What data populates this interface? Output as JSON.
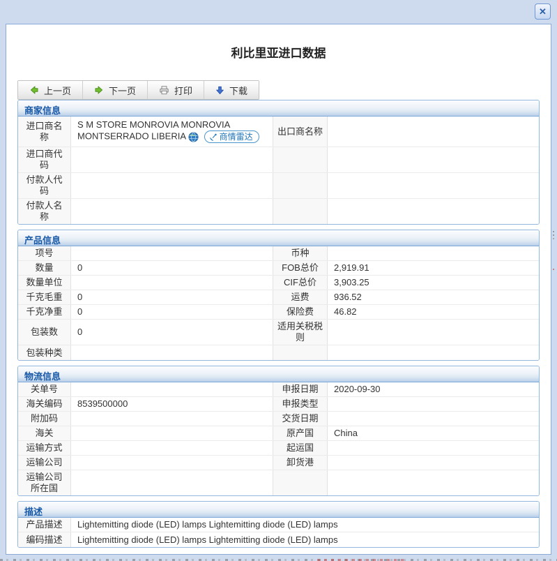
{
  "window": {
    "title": "利比里亚进口数据"
  },
  "icons": {
    "close": "✕",
    "prev": "green-left-arrow",
    "next": "green-right-arrow",
    "print": "printer",
    "download": "blue-down-arrow",
    "globe": "blue-globe",
    "radar": "satellite-dish"
  },
  "colors": {
    "page_bg": "#cedbee",
    "modal_border": "#8aabd8",
    "section_border": "#94b7de",
    "section_header_text": "#1758a7",
    "header_gradient_bottom": "#b9cfe9",
    "arrow_green": "#72bf2f",
    "download_blue": "#4271cf",
    "radar_blue": "#2e83c3",
    "text": "#333333"
  },
  "toolbar": {
    "prev": "上一页",
    "next": "下一页",
    "print": "打印",
    "download": "下载"
  },
  "merchant": {
    "title": "商家信息",
    "radar_label": "商情雷达",
    "rows": [
      {
        "l1": "进口商名称",
        "v1": "S M STORE MONROVIA MONROVIA MONTSERRADO LIBERIA",
        "l2": "出口商名称",
        "v2": ""
      },
      {
        "l1": "进口商代码",
        "v1": "",
        "l2": "",
        "v2": ""
      },
      {
        "l1": "付款人代码",
        "v1": "",
        "l2": "",
        "v2": ""
      },
      {
        "l1": "付款人名称",
        "v1": "",
        "l2": "",
        "v2": ""
      }
    ]
  },
  "product": {
    "title": "产品信息",
    "rows": [
      {
        "l1": "项号",
        "v1": "",
        "l2": "币种",
        "v2": ""
      },
      {
        "l1": "数量",
        "v1": "0",
        "l2": "FOB总价",
        "v2": "2,919.91"
      },
      {
        "l1": "数量单位",
        "v1": "",
        "l2": "CIF总价",
        "v2": "3,903.25"
      },
      {
        "l1": "千克毛重",
        "v1": "0",
        "l2": "运费",
        "v2": "936.52"
      },
      {
        "l1": "千克净重",
        "v1": "0",
        "l2": "保险费",
        "v2": "46.82"
      },
      {
        "l1": "包装数",
        "v1": "0",
        "l2": "适用关税税则",
        "v2": ""
      },
      {
        "l1": "包装种类",
        "v1": "",
        "l2": "",
        "v2": ""
      }
    ]
  },
  "logistics": {
    "title": "物流信息",
    "rows": [
      {
        "l1": "关单号",
        "v1": "",
        "l2": "申报日期",
        "v2": "2020-09-30"
      },
      {
        "l1": "海关编码",
        "v1": "8539500000",
        "l2": "申报类型",
        "v2": ""
      },
      {
        "l1": "附加码",
        "v1": "",
        "l2": "交货日期",
        "v2": ""
      },
      {
        "l1": "海关",
        "v1": "",
        "l2": "原产国",
        "v2": "China"
      },
      {
        "l1": "运输方式",
        "v1": "",
        "l2": "起运国",
        "v2": ""
      },
      {
        "l1": "运输公司",
        "v1": "",
        "l2": "卸货港",
        "v2": ""
      },
      {
        "l1": "运输公司所在国",
        "v1": "",
        "l2": "",
        "v2": ""
      }
    ]
  },
  "description": {
    "title": "描述",
    "rows": [
      {
        "l": "产品描述",
        "v": "Lightemitting diode (LED) lamps Lightemitting diode (LED) lamps"
      },
      {
        "l": "编码描述",
        "v": "Lightemitting diode (LED) lamps Lightemitting diode (LED) lamps"
      }
    ]
  }
}
